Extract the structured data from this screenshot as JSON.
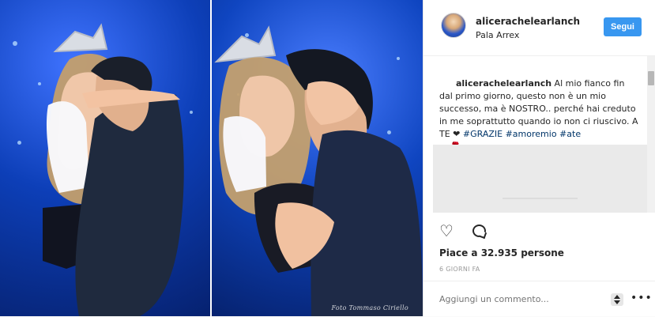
{
  "post": {
    "username": "alicerachelearlanch",
    "location": "Pala Arrex",
    "follow_label": "Segui",
    "caption": {
      "author": "alicerachelearlanch",
      "text_before_tags": " Al mio fianco fin dal primo giorno, questo non è un mio successo, ma è NOSTRO.. perché hai creduto in me soprattutto quando io non ci riuscivo. A TE ❤ ",
      "tags": [
        "#GRAZIE",
        "#amoremio",
        "#ate"
      ],
      "emojis": "👓🌹"
    },
    "likes": "Piace a 32.935 persone",
    "time": "6 GIORNI FA",
    "comment_placeholder": "Aggiungi un commento...",
    "photo_watermark": "Foto Tommaso Ciriello"
  },
  "colors": {
    "accent": "#3897f0",
    "text": "#262626",
    "secondary": "#999999",
    "photo_background": "#0b2f8f"
  }
}
